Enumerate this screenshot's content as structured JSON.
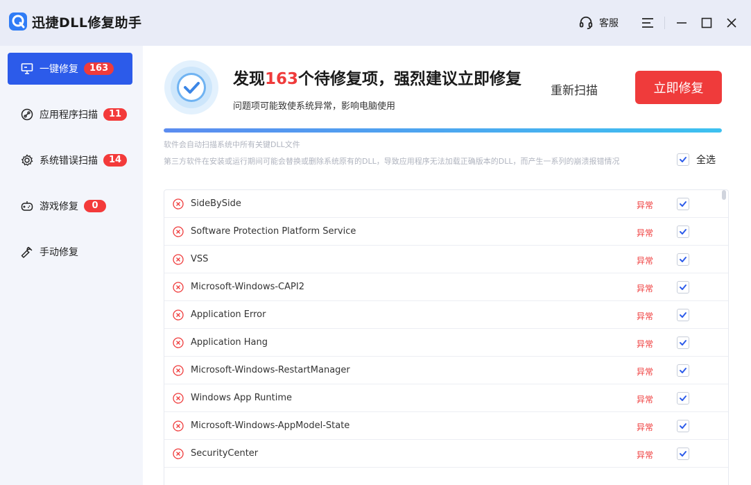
{
  "app": {
    "title": "迅捷DLL修复助手",
    "support_label": "客服"
  },
  "icons": {
    "logo": "app-logo-icon",
    "support": "headset-icon",
    "menu": "menu-icon",
    "minimize": "minimize-icon",
    "maximize": "maximize-icon",
    "close": "close-icon"
  },
  "sidebar": {
    "items": [
      {
        "label": "一键修复",
        "badge": "163",
        "icon": "monitor-icon",
        "active": true
      },
      {
        "label": "应用程序扫描",
        "badge": "11",
        "icon": "link-icon"
      },
      {
        "label": "系统错误扫描",
        "badge": "14",
        "icon": "gear-icon"
      },
      {
        "label": "游戏修复",
        "badge": "0",
        "icon": "gamepad-icon"
      },
      {
        "label": "手动修复",
        "icon": "wrench-icon"
      }
    ]
  },
  "header": {
    "headline_prefix": "发现",
    "headline_count": "163",
    "headline_suffix": "个待修复项，强烈建议立即修复",
    "subline": "问题项可能致使系统异常，影响电脑使用",
    "rescan_label": "重新扫描",
    "fix_label": "立即修复",
    "progress": 1.0
  },
  "info": {
    "line1": "软件会自动扫描系统中所有关键DLL文件",
    "line2": "第三方软件在安装或运行期间可能会替换或删除系统原有的DLL，导致应用程序无法加载正确版本的DLL，而产生一系列的崩溃报错情况",
    "select_all_label": "全选",
    "select_all_checked": true
  },
  "issues": [
    {
      "name": "SideBySide",
      "status": "异常",
      "checked": true
    },
    {
      "name": "Software Protection Platform Service",
      "status": "异常",
      "checked": true
    },
    {
      "name": "VSS",
      "status": "异常",
      "checked": true
    },
    {
      "name": "Microsoft-Windows-CAPI2",
      "status": "异常",
      "checked": true
    },
    {
      "name": "Application Error",
      "status": "异常",
      "checked": true
    },
    {
      "name": "Application Hang",
      "status": "异常",
      "checked": true
    },
    {
      "name": "Microsoft-Windows-RestartManager",
      "status": "异常",
      "checked": true
    },
    {
      "name": "Windows App Runtime",
      "status": "异常",
      "checked": true
    },
    {
      "name": "Microsoft-Windows-AppModel-State",
      "status": "异常",
      "checked": true
    },
    {
      "name": "SecurityCenter",
      "status": "异常",
      "checked": true
    }
  ],
  "colors": {
    "accent": "#2c5bea",
    "danger": "#ef3b3b"
  }
}
